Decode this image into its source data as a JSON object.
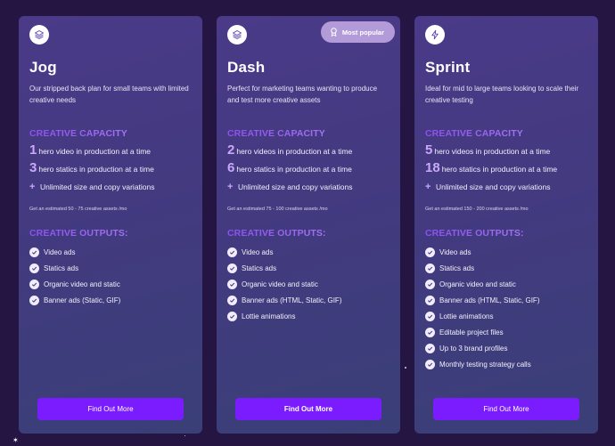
{
  "colors": {
    "background": "#251542",
    "card": "#443a82",
    "accent": "#7b1cff",
    "highlight": "#c8a8f7",
    "badge": "#b39ad8"
  },
  "plans": [
    {
      "icon": "layers-icon",
      "name": "Jog",
      "description": "Our stripped back plan for small teams with limited creative needs",
      "capacity_title": "CREATIVE CAPACITY",
      "capacity": [
        {
          "num": "1",
          "text": "hero video in production at a time"
        },
        {
          "num": "3",
          "text": "hero statics in production at a time"
        }
      ],
      "extra": "Unlimited size and copy variations",
      "estimate": "Get an estimated 50 - 75 creative assets /mo",
      "outputs_title": "CREATIVE OUTPUTS:",
      "outputs": [
        "Video ads",
        "Statics ads",
        "Organic video and static",
        "Banner ads (Static, GIF)"
      ],
      "cta": "Find Out More"
    },
    {
      "icon": "layers-icon",
      "name": "Dash",
      "badge": "Most popular",
      "description": "Perfect for marketing teams wanting to produce and test more creative assets",
      "capacity_title": "CREATIVE CAPACITY",
      "capacity": [
        {
          "num": "2",
          "text": "hero videos in production at a time"
        },
        {
          "num": "6",
          "text": "hero statics in production at a time"
        }
      ],
      "extra": "Unlimited size and copy variations",
      "estimate": "Get an estimated 75 - 100 creative assets /mo",
      "outputs_title": "CREATIVE OUTPUTS:",
      "outputs": [
        "Video ads",
        "Statics ads",
        "Organic video and static",
        "Banner ads (HTML, Static, GIF)",
        "Lottie animations"
      ],
      "cta": "Find Out More"
    },
    {
      "icon": "bolt-icon",
      "name": "Sprint",
      "description": "Ideal for mid to large teams looking to scale their creative testing",
      "capacity_title": "CREATIVE CAPACITY",
      "capacity": [
        {
          "num": "5",
          "text": "hero videos in production at a time"
        },
        {
          "num": "18",
          "text": "hero statics in production at a time"
        }
      ],
      "extra": "Unlimited size and copy variations",
      "estimate": "Get an estimated 150 - 200 creative assets /mo",
      "outputs_title": "CREATIVE OUTPUTS:",
      "outputs": [
        "Video ads",
        "Statics ads",
        "Organic video and static",
        "Banner ads (HTML, Static, GIF)",
        "Lottie animations",
        "Editable project files",
        "Up to 3 brand profiles",
        "Monthly testing strategy calls"
      ],
      "cta": "Find Out More"
    }
  ]
}
